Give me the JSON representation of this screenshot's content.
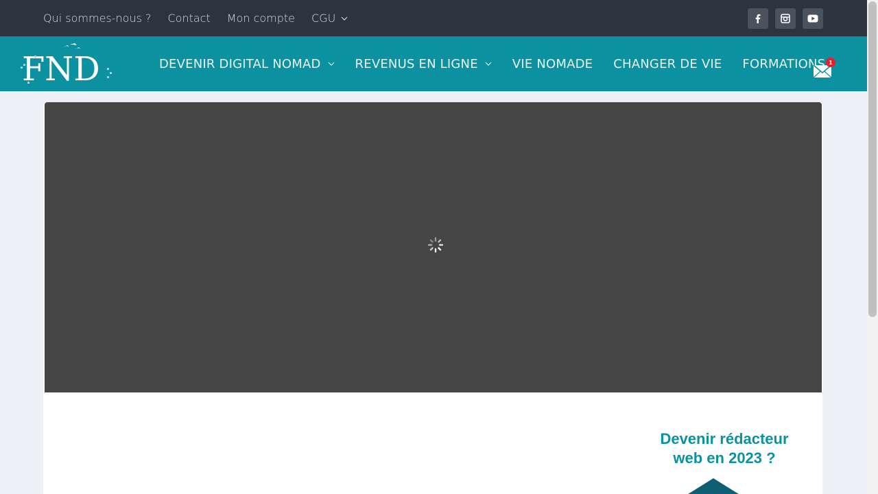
{
  "topbar": {
    "links": [
      {
        "label": "Qui sommes-nous ?"
      },
      {
        "label": "Contact"
      },
      {
        "label": "Mon compte"
      },
      {
        "label": "CGU",
        "dropdown": true
      }
    ],
    "socials": [
      "facebook-icon",
      "instagram-icon",
      "youtube-icon"
    ],
    "background": "#2c3440"
  },
  "nav": {
    "logo_text": "FND",
    "items": [
      {
        "label": "DEVENIR DIGITAL NOMAD",
        "dropdown": true
      },
      {
        "label": "REVENUS EN LIGNE",
        "dropdown": true
      },
      {
        "label": "VIE NOMADE"
      },
      {
        "label": "CHANGER DE VIE"
      },
      {
        "label": "FORMATIONS"
      }
    ],
    "mail_badge": "1",
    "background": "#0b919f"
  },
  "promo": {
    "line1": "Devenir rédacteur",
    "line2": "web en 2023 ?",
    "color": "#0b919f"
  },
  "colors": {
    "page_bg": "#edf0f4",
    "slider_bg": "#454545",
    "badge": "#e5202a"
  }
}
